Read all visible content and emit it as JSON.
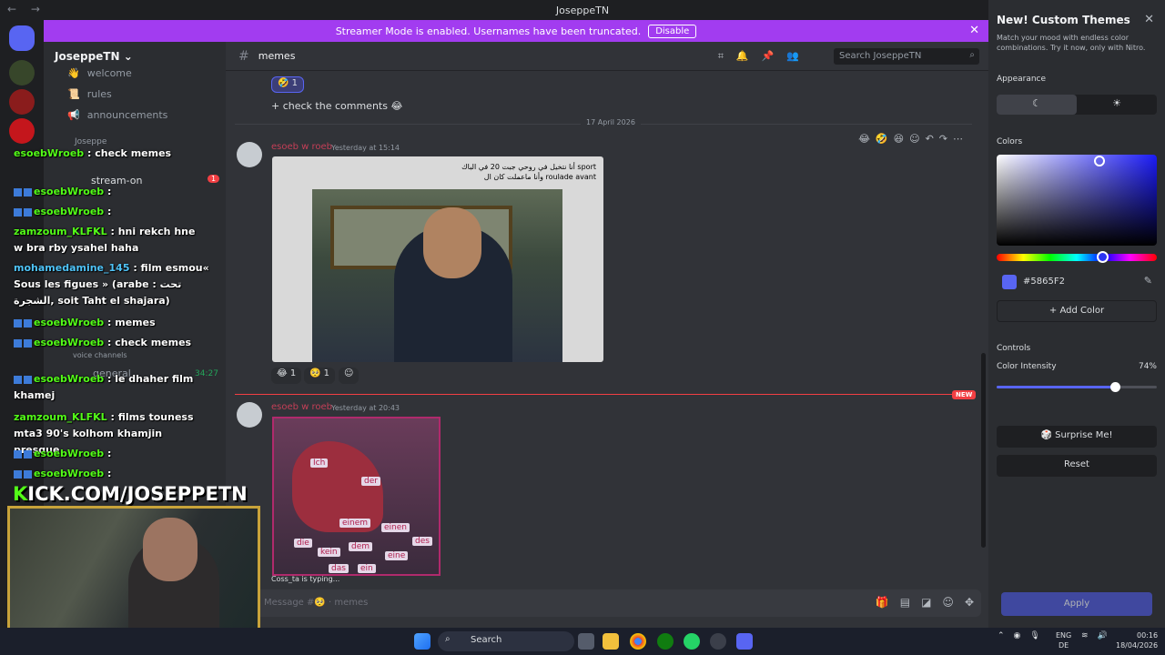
{
  "window": {
    "title": "JoseppeTN",
    "nav": "← →"
  },
  "banner": {
    "text": "Streamer Mode is enabled. Usernames have been truncated.",
    "button": "Disable"
  },
  "server": {
    "name": "JoseppeTN"
  },
  "sidebar": {
    "channels": [
      {
        "icon": "👋",
        "name": "welcome"
      },
      {
        "icon": "📜",
        "name": "rules"
      },
      {
        "icon": "📢",
        "name": "announcements"
      }
    ],
    "category": "Joseppe",
    "stream_channel": "stream-on",
    "stream_badge": "1",
    "voice_category": "voice channels",
    "voice_general": "general",
    "voice_timer": "34:27"
  },
  "chat_header": {
    "channel": "memes",
    "search_placeholder": "Search JoseppeTN"
  },
  "messages": {
    "reaction_top": {
      "emoji": "🤣",
      "count": "1"
    },
    "text_top": "+ check the comments 😂",
    "date_divider": "17 April 2026",
    "msg1": {
      "author": "esoeb w roeb",
      "time": "Yesterday at 15:14",
      "caption_line1": "أنا نتخيل في روحي جبت 20 في الباك sport",
      "caption_line2": "وأنا ماعملت كان ال roulade avant",
      "reactions": [
        {
          "emoji": "😂",
          "count": "1"
        },
        {
          "emoji": "🥺",
          "count": "1"
        }
      ]
    },
    "new_badge": "NEW",
    "msg2": {
      "author": "esoeb w roeb",
      "time": "Yesterday at 20:43",
      "tags": [
        "Ich",
        "der",
        "einem",
        "einen",
        "die",
        "dem",
        "des",
        "kein",
        "eine",
        "das",
        "ein"
      ]
    },
    "typing": "Coss_ta is typing...",
    "composer_placeholder": "Message #🥺 · memes"
  },
  "panel": {
    "title": "New! Custom Themes",
    "subtitle": "Match your mood with endless color combinations. Try it now, only with Nitro.",
    "appearance_label": "Appearance",
    "colors_label": "Colors",
    "hex": "#5865F2",
    "add_color": "Add Color",
    "controls_label": "Controls",
    "intensity_label": "Color Intensity",
    "intensity_value": "74%",
    "intensity_fraction": 0.74,
    "surprise": "Surprise Me!",
    "reset": "Reset",
    "apply": "Apply",
    "accent": "#5865F2"
  },
  "overlay": {
    "lines": [
      {
        "user": "esoebWroeb",
        "text": ": check memes"
      },
      {
        "user": "esoebWroeb",
        "text": ":"
      },
      {
        "user": "esoebWroeb",
        "text": ":"
      },
      {
        "user": "zamzoum_KLFKL",
        "text": ": hni rekch hne w bra rby ysahel haha"
      },
      {
        "user": "mohamedamine_145",
        "text": ": film esmou« Sous les figues » (arabe : تحت الشجرة, soit Taht el shajara)"
      },
      {
        "user": "esoebWroeb",
        "text": ": memes"
      },
      {
        "user": "esoebWroeb",
        "text": ": check memes"
      },
      {
        "user": "esoebWroeb",
        "text": ": le dhaher film khamej"
      },
      {
        "user": "zamzoum_KLFKL",
        "text": ": films touness mta3 90's kolhom khamjin presque"
      },
      {
        "user": "esoebWroeb",
        "text": ":"
      },
      {
        "user": "esoebWroeb",
        "text": ":"
      }
    ],
    "kick_brand": "K",
    "kick_rest": "ICK.COM/JOSEPPETN"
  },
  "taskbar": {
    "search": "Search",
    "lang1": "ENG",
    "lang2": "DE",
    "time": "00:16",
    "date": "18/04/2026"
  }
}
